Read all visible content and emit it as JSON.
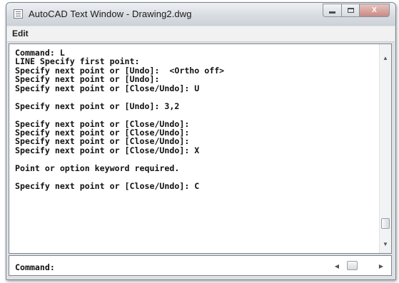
{
  "window": {
    "title": "AutoCAD Text Window - Drawing2.dwg",
    "controls": {
      "minimize_icon": "minimize-icon",
      "maximize_icon": "maximize-icon",
      "close_symbol": "X"
    }
  },
  "menubar": {
    "items": [
      {
        "label": "Edit"
      }
    ]
  },
  "history": [
    "Command: L",
    "LINE Specify first point:",
    "Specify next point or [Undo]:  <Ortho off>",
    "Specify next point or [Undo]:",
    "Specify next point or [Close/Undo]: U",
    "",
    "Specify next point or [Undo]: 3,2",
    "",
    "Specify next point or [Close/Undo]:",
    "Specify next point or [Close/Undo]:",
    "Specify next point or [Close/Undo]:",
    "Specify next point or [Close/Undo]: X",
    "",
    "Point or option keyword required.",
    "",
    "Specify next point or [Close/Undo]: C"
  ],
  "command_line": {
    "prompt": "Command:"
  },
  "scrollbars": {
    "up_glyph": "▲",
    "down_glyph": "▼",
    "left_glyph": "◀",
    "right_glyph": "▶"
  }
}
